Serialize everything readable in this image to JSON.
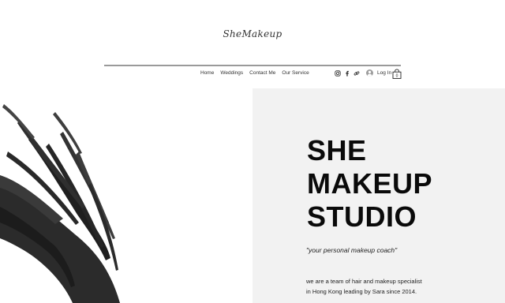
{
  "header": {
    "logo_text": "SheMakeup"
  },
  "nav": {
    "items": [
      {
        "label": "Home"
      },
      {
        "label": "Weddings"
      },
      {
        "label": "Contact Me"
      },
      {
        "label": "Our Service"
      }
    ]
  },
  "social": {
    "icons": [
      "instagram-icon",
      "facebook-icon",
      "link-icon"
    ]
  },
  "account": {
    "login_label": "Log In"
  },
  "cart": {
    "count": "0"
  },
  "hero": {
    "title_lines": [
      "SHE",
      "MAKEUP",
      "STUDIO"
    ],
    "tagline": "\"your personal makeup coach\"",
    "description_lines": [
      "we are a team of hair and makeup specialist",
      "in Hong Kong leading by Sara since 2014."
    ]
  },
  "colors": {
    "right_panel_bg": "#f2f2f2",
    "text": "#0a0a0a",
    "rule": "#9a9a9a"
  }
}
